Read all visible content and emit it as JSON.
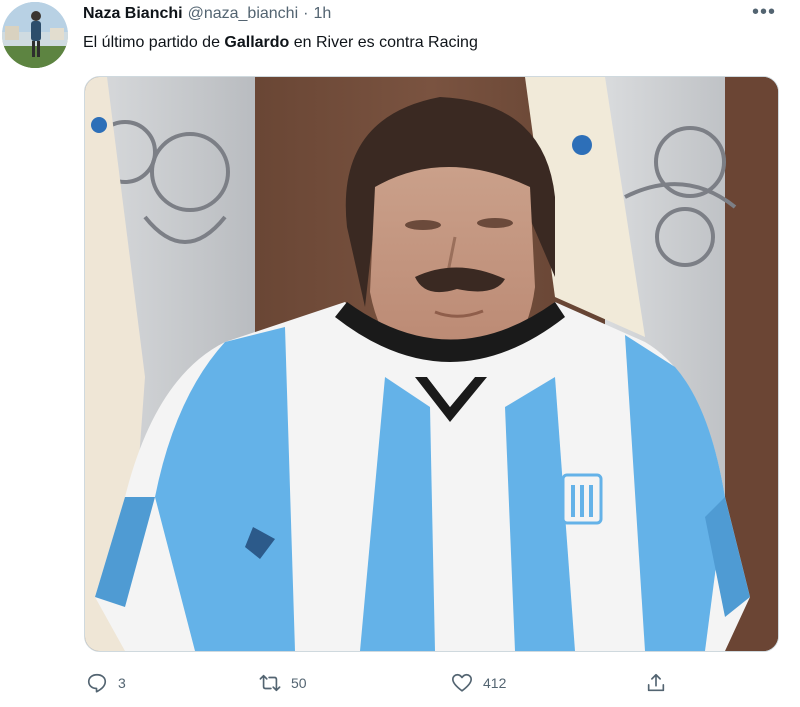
{
  "tweet": {
    "display_name": "Naza Bianchi",
    "handle": "@naza_bianchi",
    "separator": "·",
    "time": "1h",
    "more_label": "•••",
    "text_before": "El último partido de ",
    "text_bold": "Gallardo",
    "text_after": " en River es contra Racing"
  },
  "media": {
    "description_icon": "photo-image",
    "jersey_colors": {
      "light_blue": "#64b2e8",
      "white": "#f4f4f4",
      "collar": "#1a1a1a"
    }
  },
  "actions": {
    "reply_count": "3",
    "retweet_count": "50",
    "like_count": "412"
  },
  "colors": {
    "text": "#0f1419",
    "secondary": "#536471",
    "border": "#cfd9de"
  }
}
